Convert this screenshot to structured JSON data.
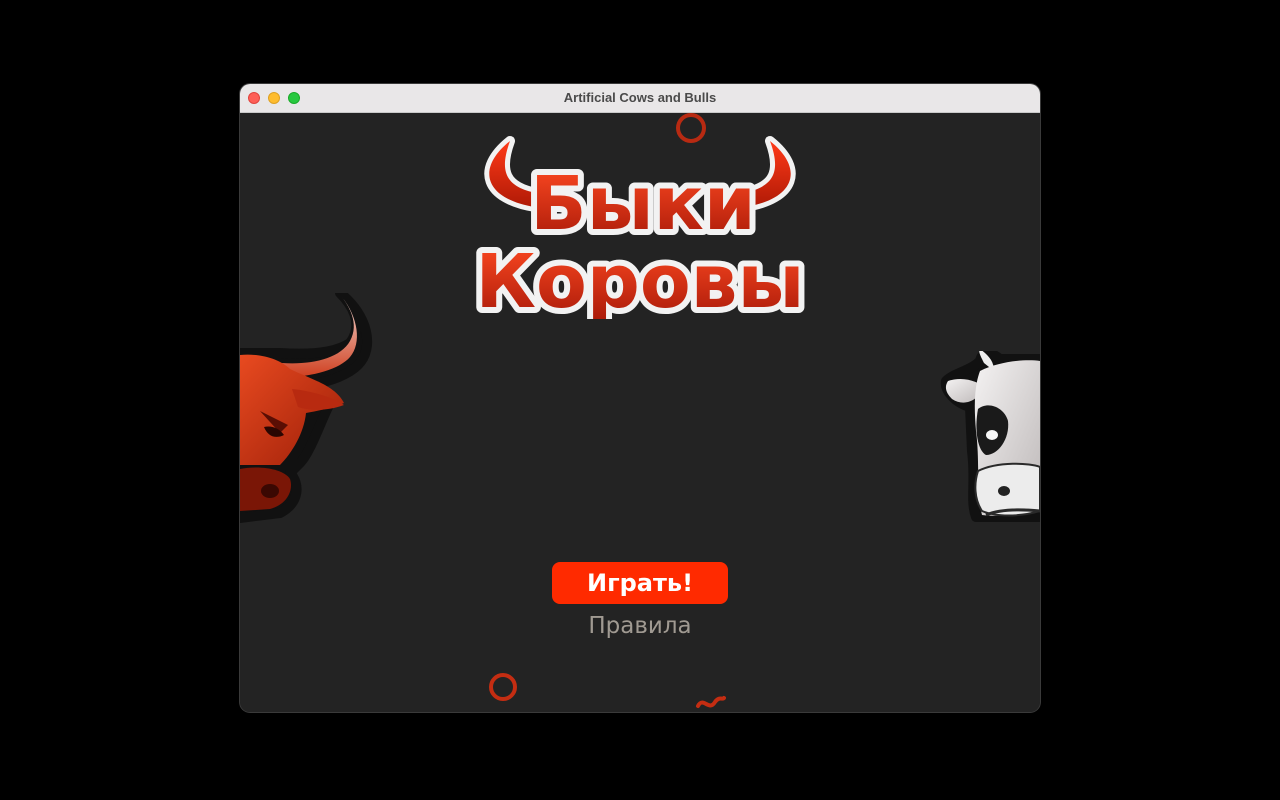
{
  "window": {
    "title": "Artificial Cows and Bulls"
  },
  "logo": {
    "line1": "Быки",
    "line2": "Коровы"
  },
  "menu": {
    "play_label": "Играть!",
    "rules_label": "Правила"
  },
  "colors": {
    "accent": "#ff2a00",
    "background": "#232323",
    "logo_red": "#d42a10",
    "rules_text": "#a09a92"
  },
  "icons": [
    "bull-illustration",
    "cow-illustration",
    "horns-icon",
    "ring-decoration",
    "squiggle-decoration"
  ]
}
